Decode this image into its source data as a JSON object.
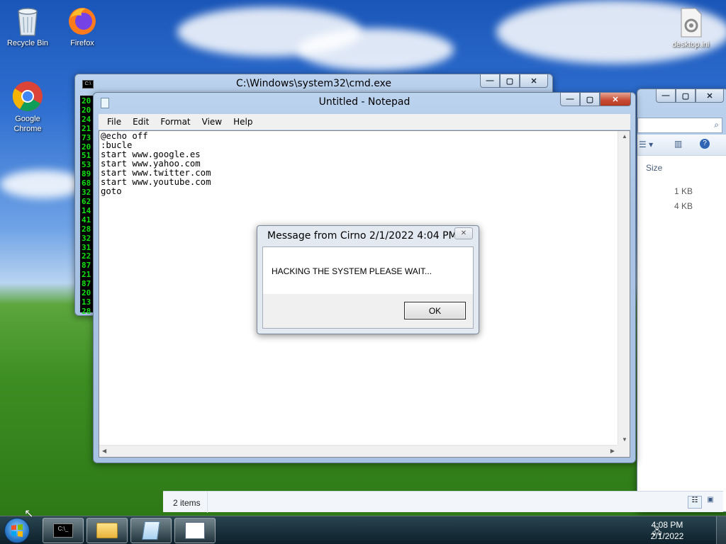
{
  "desktop": {
    "icons": [
      {
        "label": "Recycle Bin"
      },
      {
        "label": "Firefox"
      },
      {
        "label": "Google Chrome"
      },
      {
        "label": "desktop.ini"
      }
    ]
  },
  "cmd": {
    "title": "C:\\Windows\\system32\\cmd.exe",
    "lines": "20\n20\n24\n21\n73\n20\n51\n53\n89\n68\n32\n62\n14\n41\n28\n32\n31\n22\n87\n21\n87\n20\n13\n28"
  },
  "explorer": {
    "column_size": "Size",
    "rows": [
      "1 KB",
      "4 KB"
    ],
    "status": "2 items"
  },
  "notepad": {
    "title": "Untitled - Notepad",
    "menu": [
      "File",
      "Edit",
      "Format",
      "View",
      "Help"
    ],
    "content": "@echo off\n:bucle\nstart www.google.es\nstart www.yahoo.com\nstart www.twitter.com\nstart www.youtube.com\ngoto"
  },
  "msgbox": {
    "title": "Message from Cirno 2/1/2022 4:04 PM",
    "message": "HACKING THE SYSTEM PLEASE WAIT...",
    "ok_label": "OK"
  },
  "taskbar": {
    "time": "4:08 PM",
    "date": "2/1/2022"
  }
}
